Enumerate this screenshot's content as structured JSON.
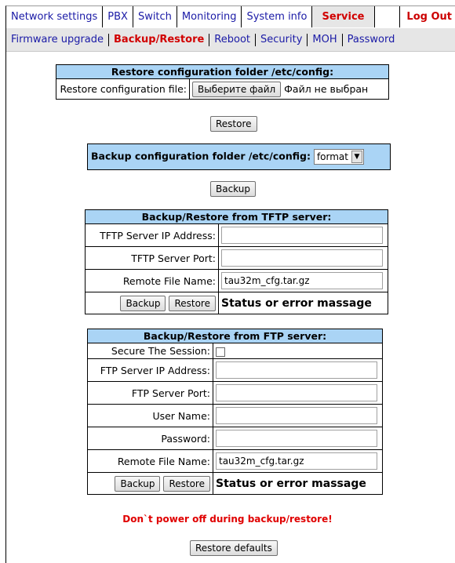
{
  "top_menu": {
    "items": [
      "Network settings",
      "PBX",
      "Switch",
      "Monitoring",
      "System info",
      "Service"
    ],
    "active": "Service",
    "logout": "Log Out"
  },
  "sub_menu": {
    "items": [
      "Firmware upgrade",
      "Backup/Restore",
      "Reboot",
      "Security",
      "MOH",
      "Password"
    ],
    "active": "Backup/Restore"
  },
  "restore_panel": {
    "header": "Restore configuration folder /etc/config:",
    "file_label": "Restore configuration file:",
    "choose_button": "Выберите файл",
    "no_file_text": "Файл не выбран",
    "restore_button": "Restore"
  },
  "backup_panel": {
    "label": "Backup configuration folder /etc/config:",
    "format_value": "format",
    "backup_button": "Backup"
  },
  "tftp_panel": {
    "header": "Backup/Restore from TFTP server:",
    "ip_label": "TFTP Server IP Address:",
    "ip_value": "",
    "port_label": "TFTP Server Port:",
    "port_value": "",
    "remote_label": "Remote File Name:",
    "remote_value": "tau32m_cfg.tar.gz",
    "backup_button": "Backup",
    "restore_button": "Restore",
    "status": "Status or error massage"
  },
  "ftp_panel": {
    "header": "Backup/Restore from FTP server:",
    "secure_label": "Secure The Session:",
    "ip_label": "FTP Server IP Address:",
    "ip_value": "",
    "port_label": "FTP Server Port:",
    "port_value": "",
    "user_label": "User Name:",
    "user_value": "",
    "password_label": "Password:",
    "password_value": "",
    "remote_label": "Remote File Name:",
    "remote_value": "tau32m_cfg.tar.gz",
    "backup_button": "Backup",
    "restore_button": "Restore",
    "status": "Status or error massage"
  },
  "warning": "Don`t power off during backup/restore!",
  "restore_defaults_button": "Restore defaults",
  "colors": {
    "header_bg": "#aad4f5",
    "menu_link": "#1a1aa6",
    "active_red": "#d10000",
    "warning_red": "#e00000"
  }
}
